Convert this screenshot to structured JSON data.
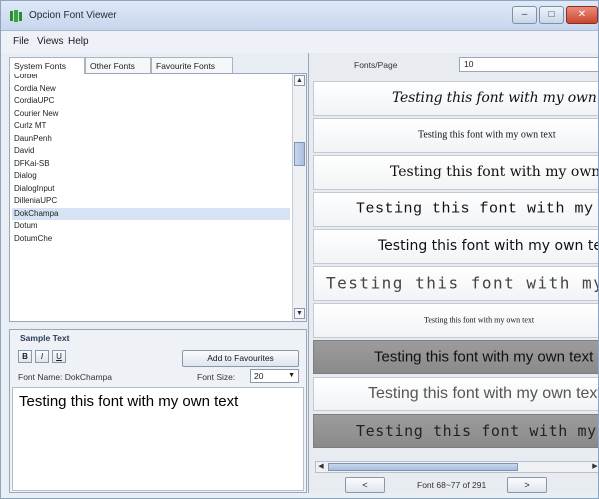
{
  "window": {
    "title": "Opcion Font Viewer",
    "icon": "app-logo-icon",
    "controls": {
      "minimize": "–",
      "maximize": "□",
      "close": "✕"
    }
  },
  "menu": [
    "File",
    "Views",
    "Help"
  ],
  "tabs": [
    {
      "label": "System Fonts",
      "active": true
    },
    {
      "label": "Other Fonts",
      "active": false
    },
    {
      "label": "Favourite Fonts",
      "active": false
    }
  ],
  "font_list": {
    "items": [
      "Corbel",
      "Cordia New",
      "CordiaUPC",
      "Courier New",
      "Curlz MT",
      "DaunPenh",
      "David",
      "DFKai-SB",
      "Dialog",
      "DialogInput",
      "DilleniaUPC",
      "DokChampa",
      "Dotum",
      "DotumChe"
    ],
    "selected": "DokChampa"
  },
  "sample_panel": {
    "legend": "Sample Text",
    "bold_label": "B",
    "italic_label": "I",
    "underline_label": "U",
    "add_favourite_label": "Add to Favourites",
    "font_name_label": "Font Name: DokChampa",
    "font_size_label": "Font Size:",
    "font_size_value": "20",
    "text": "Testing this font with my own text"
  },
  "preview": {
    "fonts_per_page_label": "Fonts/Page",
    "fonts_per_page_value": "10",
    "rows": [
      "Testing this font with my own text",
      "Testing this font with my own text",
      "Testing this font with my own text",
      "Testing this font with my own text",
      "Testing this font with my own text",
      "Testing this font with my own text",
      "Testing this font with my own text",
      "Testing this font with my own text",
      "Testing this font with my own text",
      "Testing this font with my own text"
    ],
    "prev_label": "<",
    "next_label": ">",
    "page_info": "Font 68~77 of 291"
  },
  "colors": {
    "selected_row": "#d5e3f5",
    "dark_row": "#8f8f8f",
    "title_gradient_top": "#dfe9f7",
    "close_button": "#c8462f"
  }
}
